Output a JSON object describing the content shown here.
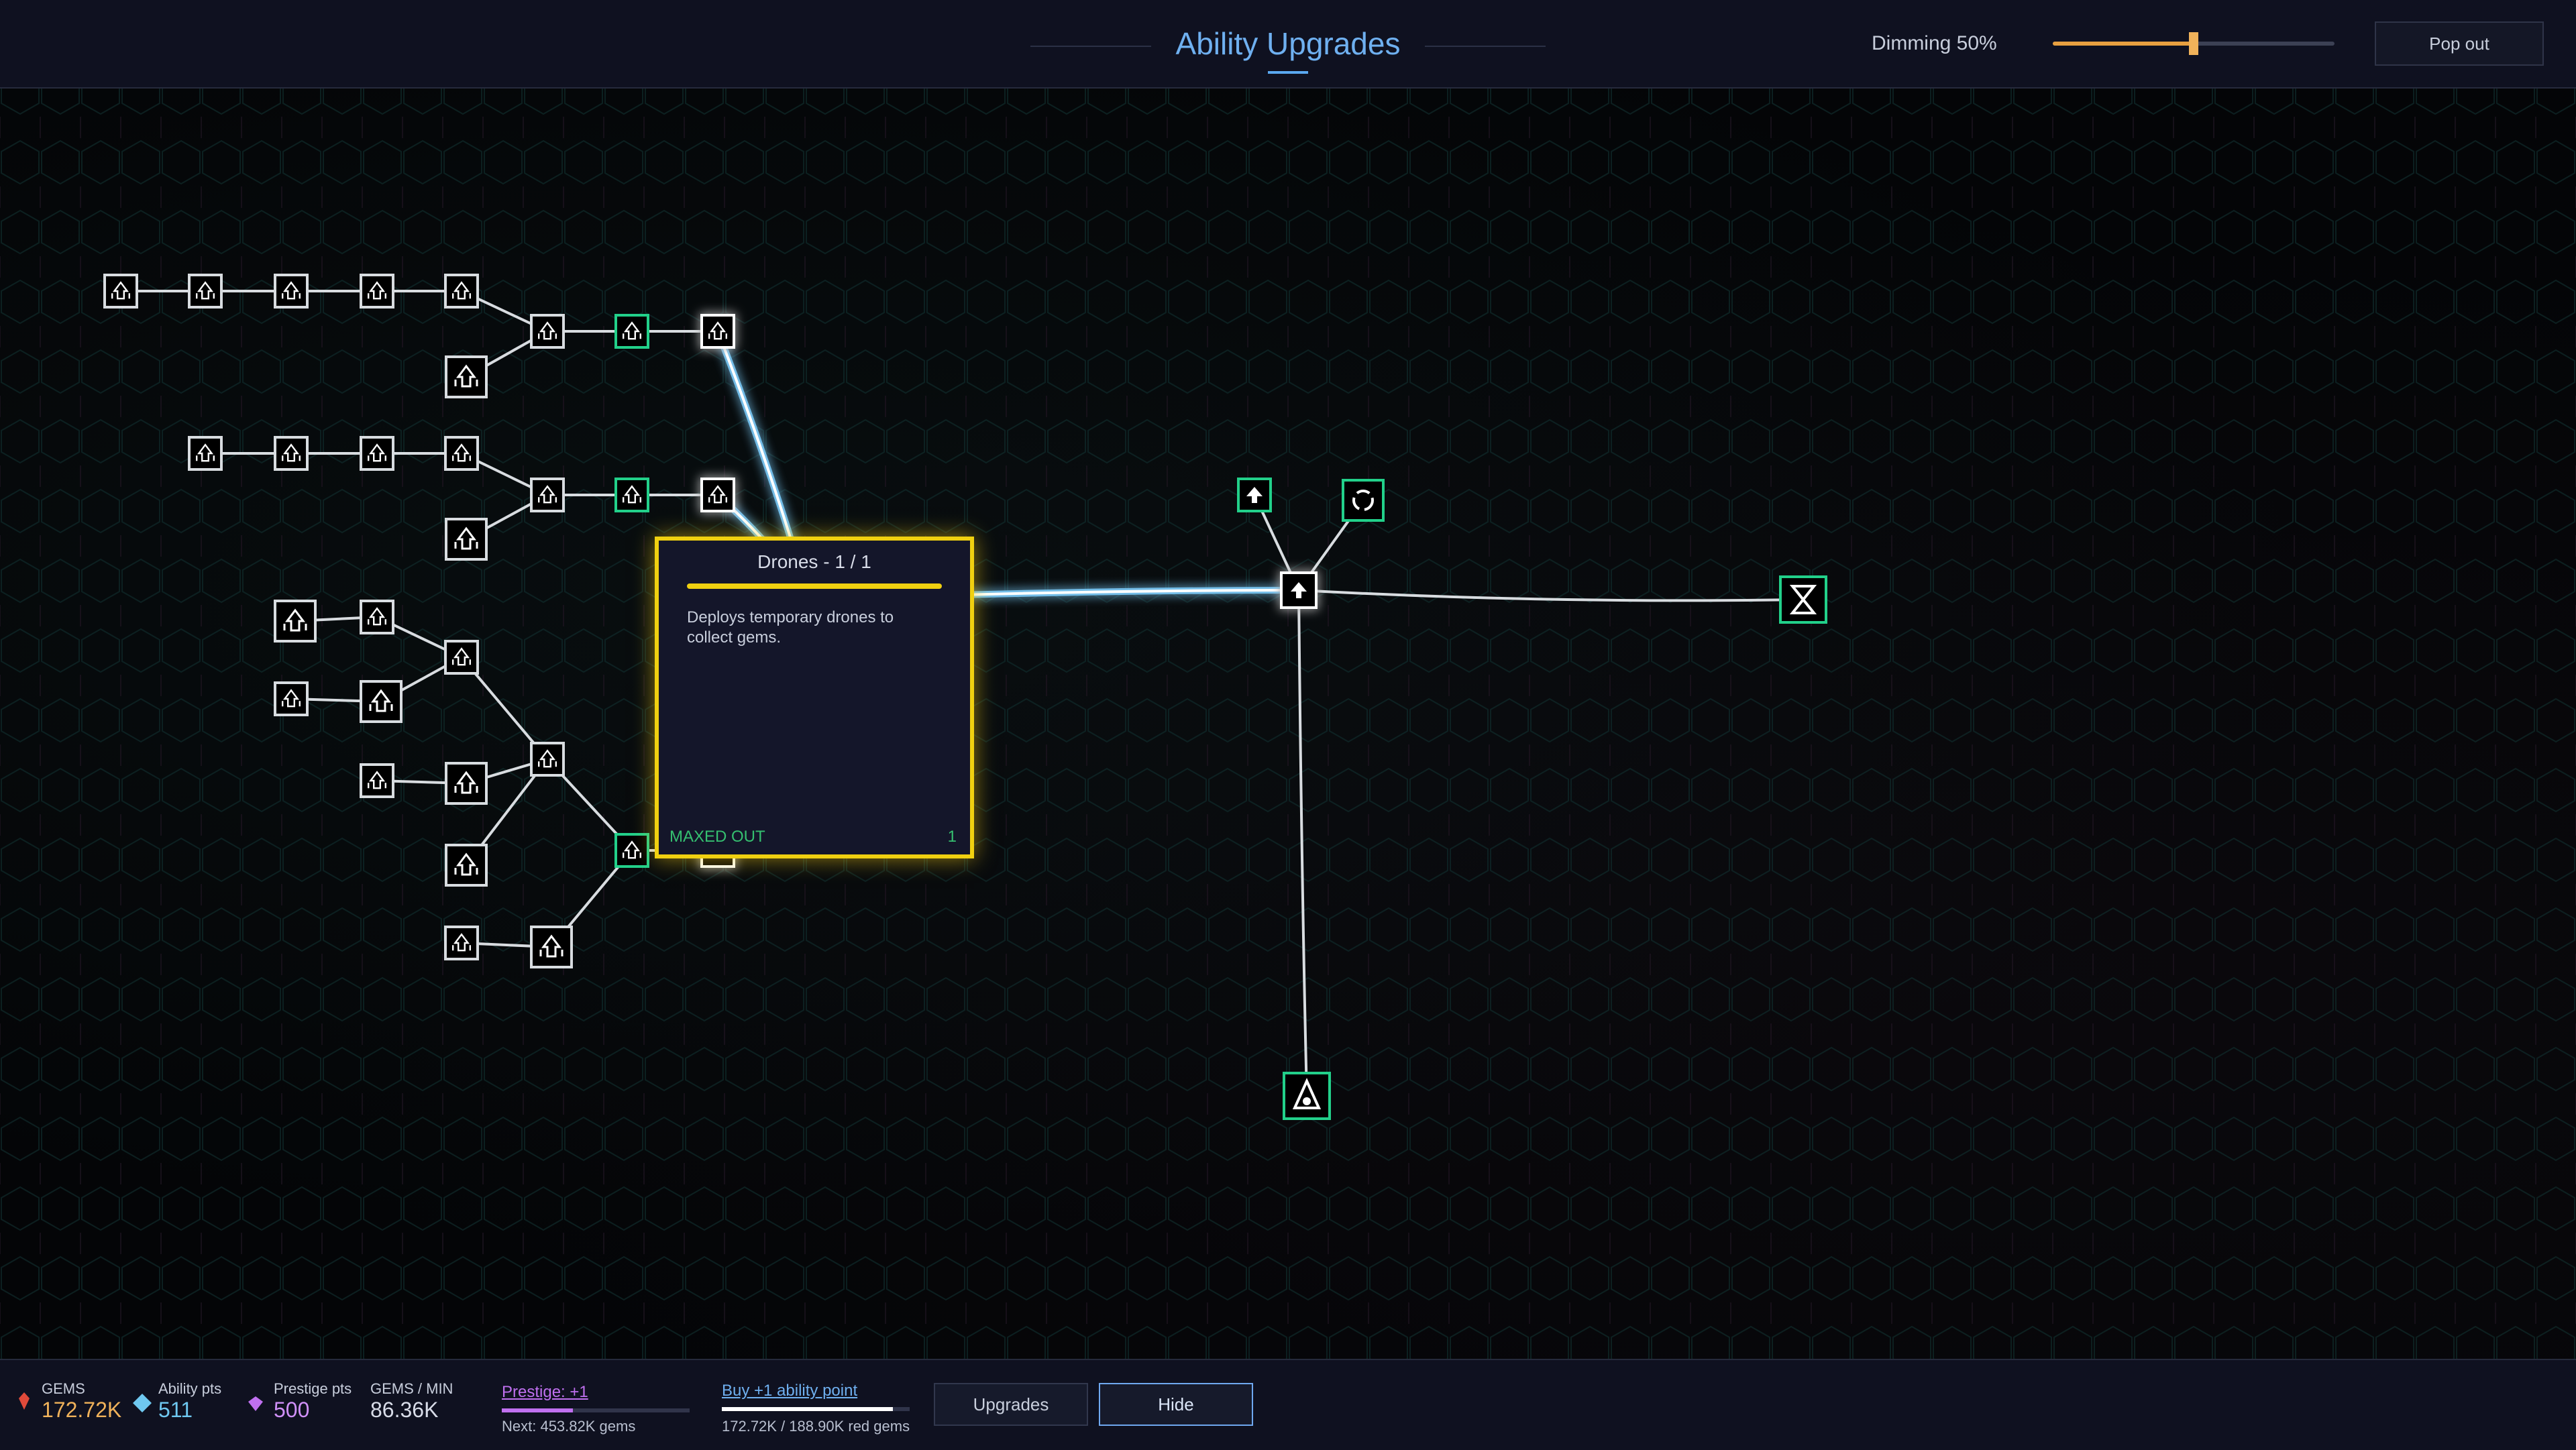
{
  "header": {
    "title": "Ability Upgrades",
    "dimming_label": "Dimming 50%",
    "dimming_value": 0.5,
    "popout_label": "Pop out"
  },
  "tooltip": {
    "title": "Drones - 1 / 1",
    "description": "Deploys temporary drones to collect gems.",
    "status": "MAXED OUT",
    "level": "1"
  },
  "stats": {
    "gems_label": "GEMS",
    "gems_value": "172.72K",
    "ability_label": "Ability pts",
    "ability_value": "511",
    "prestige_label": "Prestige pts",
    "prestige_value": "500",
    "gpm_label": "GEMS / MIN",
    "gpm_value": "86.36K"
  },
  "prestige": {
    "label": "Prestige: +1",
    "next": "Next: 453.82K gems",
    "progress": 0.38
  },
  "buy": {
    "label": "Buy +1 ability point",
    "detail": "172.72K / 188.90K red gems",
    "progress": 0.91
  },
  "buttons": {
    "upgrades": "Upgrades",
    "hide": "Hide"
  },
  "colors": {
    "accent": "#6fb0f0",
    "tooltip_border": "#f0d010",
    "maxed": "#35c070",
    "node_owned": "#22d08a",
    "glow": "#7fd0ff"
  },
  "icons": [
    "arrow-up-icon",
    "drone-icon",
    "orbit-icon",
    "hourglass-icon",
    "ship-icon",
    "gem-icon"
  ]
}
